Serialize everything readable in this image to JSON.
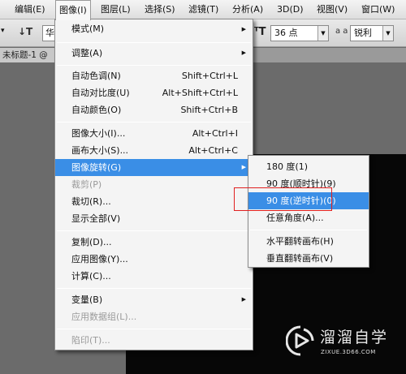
{
  "menubar": {
    "items": [
      {
        "label": "编辑(E)"
      },
      {
        "label": "图像(I)"
      },
      {
        "label": "图层(L)"
      },
      {
        "label": "选择(S)"
      },
      {
        "label": "滤镜(T)"
      },
      {
        "label": "分析(A)"
      },
      {
        "label": "3D(D)"
      },
      {
        "label": "视图(V)"
      },
      {
        "label": "窗口(W)"
      }
    ],
    "active_index": 1
  },
  "options_bar": {
    "font_prefix": "华",
    "font_size": "36 点",
    "aa_label": "a a",
    "antialias": "锐利"
  },
  "document": {
    "tab_label": "未标题-1 @"
  },
  "image_menu": {
    "items": [
      {
        "label": "模式(M)",
        "submenu": true
      },
      {
        "label": "调整(A)",
        "submenu": true
      },
      {
        "label": "自动色调(N)",
        "shortcut": "Shift+Ctrl+L"
      },
      {
        "label": "自动对比度(U)",
        "shortcut": "Alt+Shift+Ctrl+L"
      },
      {
        "label": "自动颜色(O)",
        "shortcut": "Shift+Ctrl+B"
      },
      {
        "label": "图像大小(I)...",
        "shortcut": "Alt+Ctrl+I"
      },
      {
        "label": "画布大小(S)...",
        "shortcut": "Alt+Ctrl+C"
      },
      {
        "label": "图像旋转(G)",
        "submenu": true,
        "highlighted": true
      },
      {
        "label": "裁剪(P)",
        "disabled": true
      },
      {
        "label": "裁切(R)..."
      },
      {
        "label": "显示全部(V)"
      },
      {
        "label": "复制(D)..."
      },
      {
        "label": "应用图像(Y)..."
      },
      {
        "label": "计算(C)..."
      },
      {
        "label": "变量(B)",
        "submenu": true
      },
      {
        "label": "应用数据组(L)...",
        "disabled": true
      },
      {
        "label": "陷印(T)...",
        "disabled": true
      }
    ]
  },
  "rotate_submenu": {
    "items": [
      {
        "label": "180 度(1)"
      },
      {
        "label": "90 度(顺时针)(9)"
      },
      {
        "label": "90 度(逆时针)(0)",
        "highlighted": true
      },
      {
        "label": "任意角度(A)..."
      },
      {
        "label": "水平翻转画布(H)"
      },
      {
        "label": "垂直翻转画布(V)"
      }
    ]
  },
  "watermark": {
    "title": "溜溜自学",
    "url": "ZIXUE.3D66.COM"
  },
  "colors": {
    "highlight": "#3a8ee6",
    "annotation": "#e02020",
    "canvas": "#070707"
  }
}
